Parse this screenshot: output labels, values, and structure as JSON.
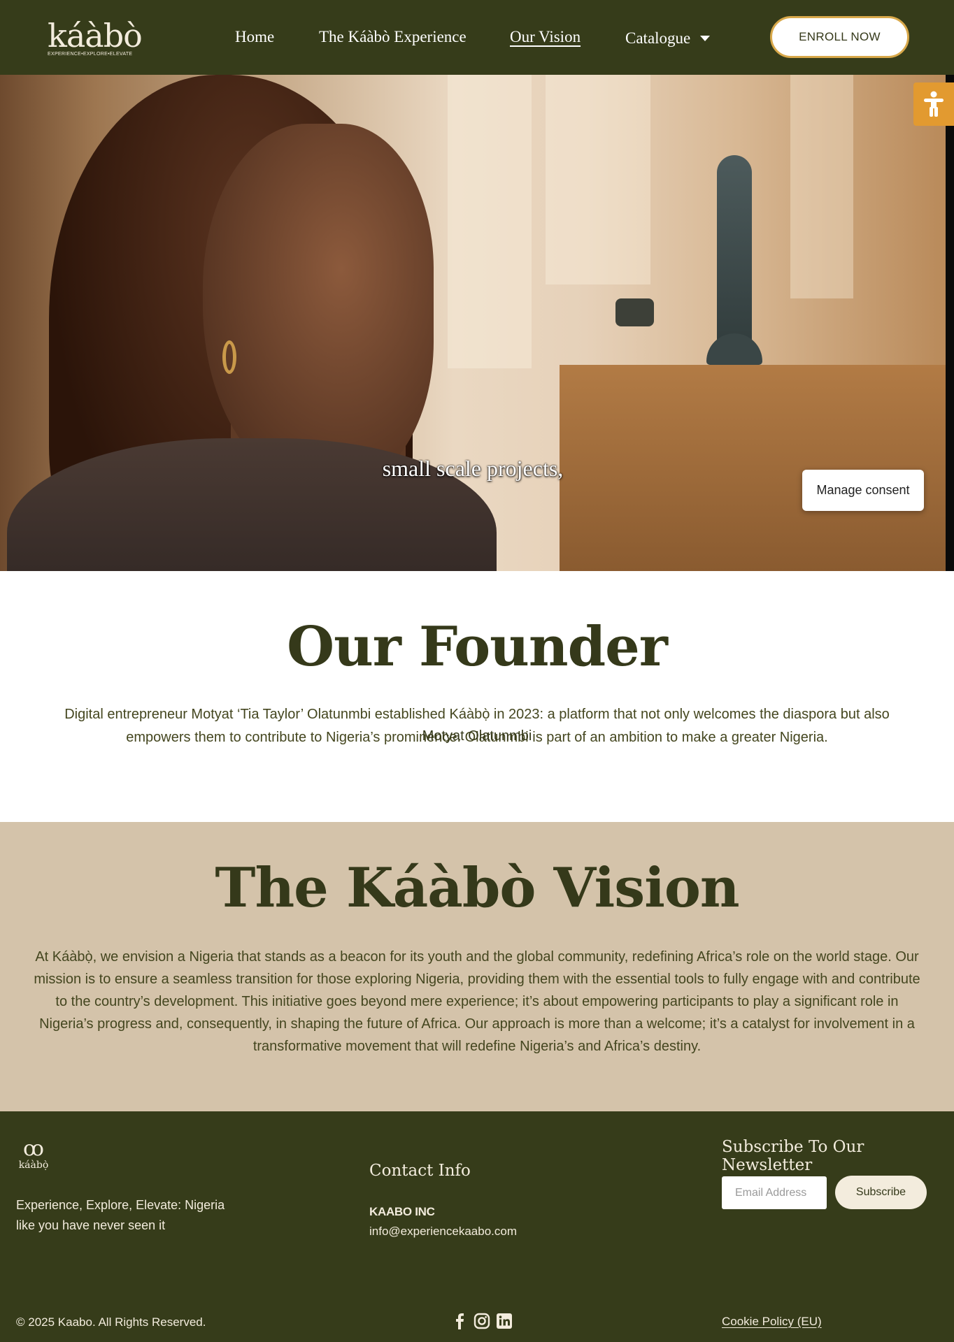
{
  "header": {
    "logo_text": "káàbò",
    "logo_tagline": "EXPERIENCE•EXPLORE•ELEVATE",
    "nav": {
      "home": "Home",
      "experience": "The Káàbò Experience",
      "vision": "Our Vision",
      "catalogue": "Catalogue"
    },
    "enroll_label": "ENROLL NOW"
  },
  "hero": {
    "caption": "small scale projects,",
    "consent_label": "Manage consent",
    "accessibility_icon": "accessibility-icon"
  },
  "founder": {
    "title": "Our Founder",
    "text": "Digital entrepreneur Motyat ‘Tia Taylor’ Olatunmbi established Káàbọ̀ in 2023: a platform that not only welcomes the diaspora but also empowers them to contribute to Nigeria’s prominence. Olatunmbi is part of an ambition to make a greater Nigeria.",
    "overlay_name": "Motyat Olatunmbi"
  },
  "vision": {
    "title": "The Káàbò Vision",
    "text": "At Káàbọ̀, we envision a Nigeria that stands as a beacon for its youth and the global community, redefining Africa’s role on the world stage. Our mission is to ensure a seamless transition for those exploring Nigeria, providing them with the essential tools to fully engage with and contribute to the country’s development. This initiative goes beyond mere experience; it’s about empowering participants to play a significant role in Nigeria’s progress and, consequently, in shaping the future of Africa. Our approach is more than a welcome; it’s a catalyst for involvement in a transformative movement that will redefine Nigeria’s and Africa’s destiny."
  },
  "footer": {
    "logo_mark": "ꝏ",
    "logo_word": "káàbọ̀",
    "tagline": "Experience, Explore, Elevate: Nigeria like you have never seen it",
    "contact_title": "Contact Info",
    "company": "KAABO INC",
    "email": "info@experiencekaabo.com",
    "newsletter_title": "Subscribe To Our Newsletter",
    "email_placeholder": "Email Address",
    "subscribe_label": "Subscribe",
    "copyright": "© 2025 Kaabo. All Rights Reserved.",
    "cookie_label": "Cookie Policy (EU)",
    "socials": [
      "facebook-icon",
      "instagram-icon",
      "linkedin-icon"
    ]
  },
  "colors": {
    "olive": "#363c1a",
    "sand": "#d4c3aa",
    "cream": "#f3ecdd",
    "gold": "#d8a84a",
    "accessibility_orange": "#e29a30"
  }
}
